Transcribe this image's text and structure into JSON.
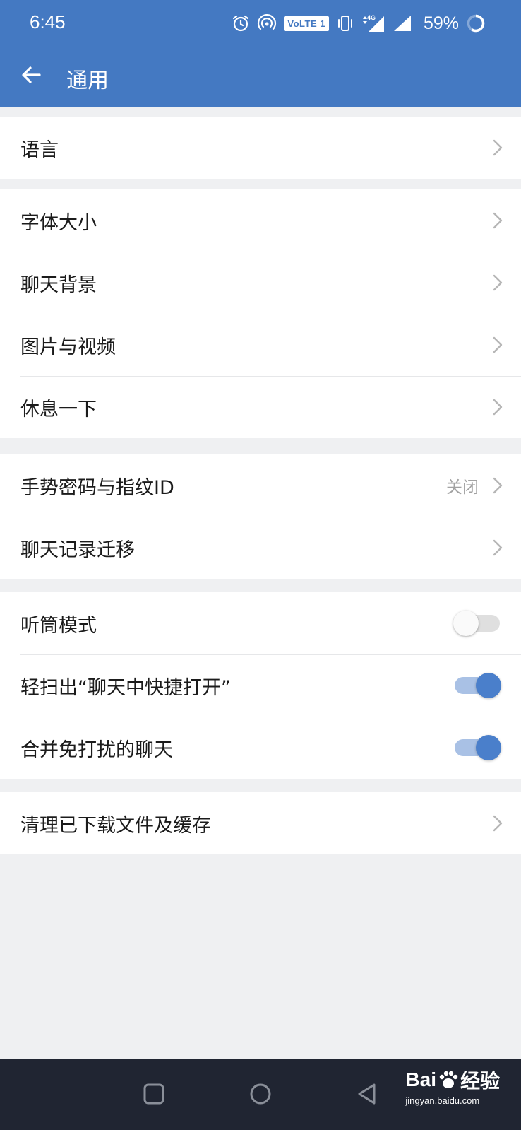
{
  "status_bar": {
    "time": "6:45",
    "volte": "VoLTE 1",
    "network": "4G",
    "battery": "59%",
    "icons": [
      "alarm-icon",
      "hotspot-icon",
      "vibrate-icon",
      "signal-icon",
      "battery-ring-icon"
    ]
  },
  "header": {
    "title": "通用",
    "back_icon": "arrow-left-icon",
    "background": "#4479c2"
  },
  "groups": [
    {
      "items": [
        {
          "label": "语言"
        }
      ]
    },
    {
      "items": [
        {
          "label": "字体大小"
        },
        {
          "label": "聊天背景"
        },
        {
          "label": "图片与视频"
        },
        {
          "label": "休息一下"
        }
      ]
    },
    {
      "items": [
        {
          "label": "手势密码与指纹ID",
          "value": "关闭"
        },
        {
          "label": "聊天记录迁移"
        }
      ]
    },
    {
      "items": [
        {
          "label": "听筒模式",
          "toggle": false
        },
        {
          "label": "轻扫出“聊天中快捷打开”",
          "toggle": true
        },
        {
          "label": "合并免打扰的聊天",
          "toggle": true
        }
      ]
    },
    {
      "items": [
        {
          "label": "清理已下载文件及缓存"
        }
      ]
    }
  ],
  "colors": {
    "accent": "#4479c2",
    "toggle_on": "#4a7fcb",
    "page_bg": "#eff0f2"
  },
  "nav_bar": {
    "buttons": [
      "recents-square-icon",
      "home-circle-icon",
      "back-triangle-icon"
    ]
  },
  "watermark": {
    "brand": "Bai",
    "brand_suffix": "经验",
    "url": "jingyan.baidu.com"
  }
}
